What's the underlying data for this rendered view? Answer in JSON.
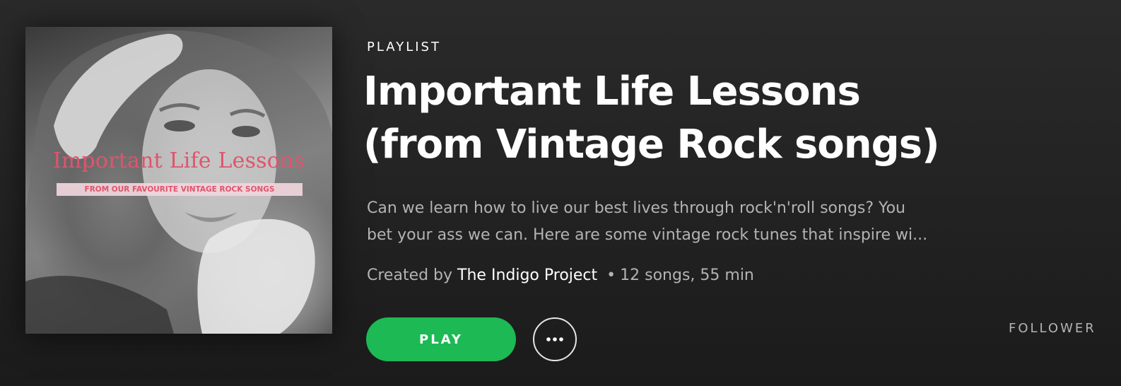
{
  "playlist": {
    "type_label": "PLAYLIST",
    "title_line1": "Important Life Lessons",
    "title_line2": "(from Vintage Rock songs)",
    "description_line1": "Can we learn how to live our best lives through rock'n'roll songs? You",
    "description_line2": "bet your ass we can. Here are some vintage rock tunes that inspire wi...",
    "created_by_prefix": "Created by",
    "creator": "The Indigo Project",
    "separator": "•",
    "stats": "12 songs, 55 min"
  },
  "cover": {
    "title": "Important Life Lessons",
    "subtitle": "FROM OUR FAVOURITE VINTAGE ROCK SONGS"
  },
  "actions": {
    "play_label": "PLAY",
    "more_icon": "ellipsis-icon",
    "followers_label": "FOLLOWER"
  },
  "colors": {
    "accent_green": "#1db954",
    "cover_text_pink": "#e0546c",
    "secondary_text": "#b3b3b3",
    "background": "#222222"
  }
}
